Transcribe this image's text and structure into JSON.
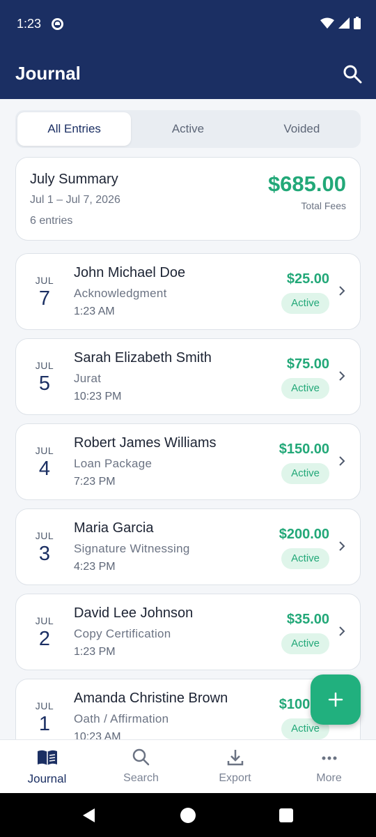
{
  "status_bar": {
    "time": "1:23"
  },
  "app_bar": {
    "title": "Journal"
  },
  "tabs": [
    {
      "label": "All Entries",
      "selected": true
    },
    {
      "label": "Active",
      "selected": false
    },
    {
      "label": "Voided",
      "selected": false
    }
  ],
  "summary": {
    "title": "July Summary",
    "date_range": "Jul 1 – Jul 7, 2026",
    "entry_count": "6 entries",
    "total_amount": "$685.00",
    "total_label": "Total Fees"
  },
  "entries": [
    {
      "month": "JUL",
      "day": "7",
      "name": "John Michael Doe",
      "type": "Acknowledgment",
      "time": "1:23 AM",
      "amount": "$25.00",
      "status": "Active"
    },
    {
      "month": "JUL",
      "day": "5",
      "name": "Sarah Elizabeth Smith",
      "type": "Jurat",
      "time": "10:23 PM",
      "amount": "$75.00",
      "status": "Active"
    },
    {
      "month": "JUL",
      "day": "4",
      "name": "Robert James Williams",
      "type": "Loan Package",
      "time": "7:23 PM",
      "amount": "$150.00",
      "status": "Active"
    },
    {
      "month": "JUL",
      "day": "3",
      "name": "Maria Garcia",
      "type": "Signature Witnessing",
      "time": "4:23 PM",
      "amount": "$200.00",
      "status": "Active"
    },
    {
      "month": "JUL",
      "day": "2",
      "name": "David Lee Johnson",
      "type": "Copy Certification",
      "time": "1:23 PM",
      "amount": "$35.00",
      "status": "Active"
    },
    {
      "month": "JUL",
      "day": "1",
      "name": "Amanda Christine Brown",
      "type": "Oath / Affirmation",
      "time": "10:23 AM",
      "amount": "$100.00",
      "status": "Active"
    }
  ],
  "bottom_nav": [
    {
      "label": "Journal",
      "icon": "book-icon",
      "active": true
    },
    {
      "label": "Search",
      "icon": "search-icon",
      "active": false
    },
    {
      "label": "Export",
      "icon": "download-icon",
      "active": false
    },
    {
      "label": "More",
      "icon": "more-icon",
      "active": false
    }
  ],
  "colors": {
    "primary": "#1b2f63",
    "accent_green": "#22a878",
    "fab": "#21b07e"
  }
}
